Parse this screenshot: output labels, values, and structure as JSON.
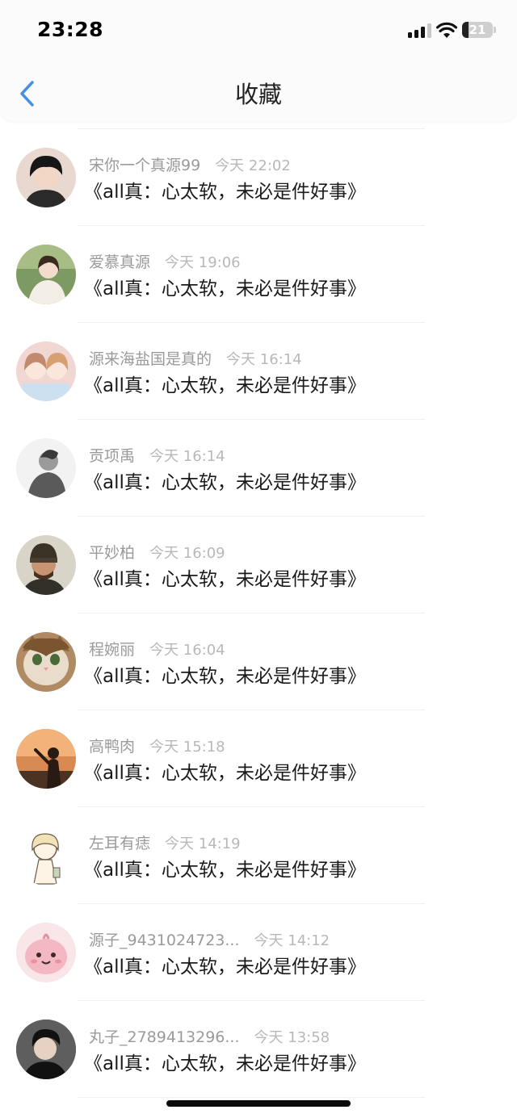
{
  "status_bar": {
    "time": "23:28",
    "battery_level": "21",
    "battery_fraction": 0.21,
    "signal_icon": "cellular-signal-icon",
    "wifi_icon": "wifi-icon",
    "battery_icon": "battery-icon"
  },
  "header": {
    "title": "收藏",
    "back_icon": "chevron-left-icon",
    "accent_color": "#4a90e2"
  },
  "favorites": [
    {
      "user": "宋你一个真源99",
      "time": "今天 22:02",
      "title": "《all真：心太软，未必是件好事》",
      "avatar": "boy-portrait"
    },
    {
      "user": "爱慕真源",
      "time": "今天 19:06",
      "title": "《all真：心太软，未必是件好事》",
      "avatar": "girl-in-garden"
    },
    {
      "user": "源来海盐国是真的",
      "time": "今天 16:14",
      "title": "《all真：心太软，未必是件好事》",
      "avatar": "two-anime-girls"
    },
    {
      "user": "贡项禹",
      "time": "今天 16:14",
      "title": "《all真：心太软，未必是件好事》",
      "avatar": "grayscale-figure"
    },
    {
      "user": "平妙柏",
      "time": "今天 16:09",
      "title": "《all真：心太软，未必是件好事》",
      "avatar": "man-in-beanie"
    },
    {
      "user": "程婉丽",
      "time": "今天 16:04",
      "title": "《all真：心太软，未必是件好事》",
      "avatar": "cat"
    },
    {
      "user": "高鸭肉",
      "time": "今天 15:18",
      "title": "《all真：心太软，未必是件好事》",
      "avatar": "sunset-silhouette"
    },
    {
      "user": "左耳有痣",
      "time": "今天 14:19",
      "title": "《all真：心太软，未必是件好事》",
      "avatar": "anime-sketch-girl"
    },
    {
      "user": "源子_9431024723...",
      "time": "今天 14:12",
      "title": "《all真：心太软，未必是件好事》",
      "avatar": "pink-cartoon"
    },
    {
      "user": "丸子_2789413296...",
      "time": "今天 13:58",
      "title": "《all真：心太软，未必是件好事》",
      "avatar": "dark-haired-boy"
    }
  ]
}
